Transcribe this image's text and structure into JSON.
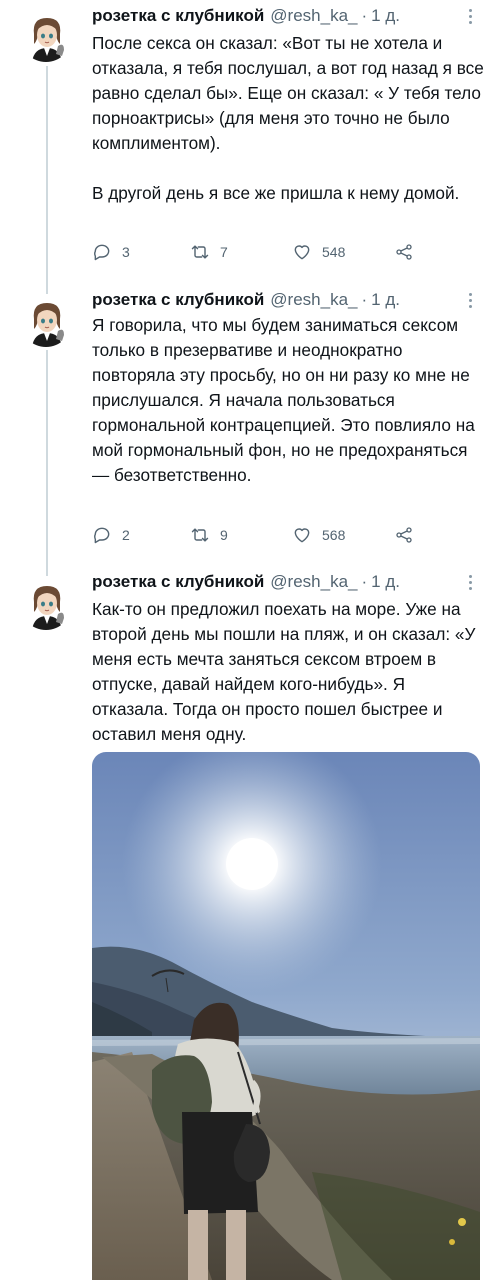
{
  "colors": {
    "text": "#0f1419",
    "secondary": "#536471",
    "line": "#cfd9de",
    "icon": "#536471"
  },
  "tweets": [
    {
      "name": "розетка с клубникой",
      "handle": "@resh_ka_",
      "separator": "·",
      "time": "1 д.",
      "text": "После секса он сказал: «Вот ты не хотела и отказала, я тебя послушал, а вот год назад я все равно сделал бы». Еще он сказал: « У тебя тело порноактрисы» (для меня это точно не было комплиментом).\n\nВ другой день я все же пришла к нему домой.",
      "replies": "3",
      "retweets": "7",
      "likes": "548"
    },
    {
      "name": "розетка с клубникой",
      "handle": "@resh_ka_",
      "separator": "·",
      "time": "1 д.",
      "text": "Я говорила, что мы будем заниматься сексом только в презервативе и неоднократно повторяла эту просьбу, но он ни разу ко мне не прислушался. Я начала пользоваться  гормональной контрацепцией. Это повлияло на мой гормональный фон, но не предохраняться — безответственно.",
      "replies": "2",
      "retweets": "9",
      "likes": "568"
    },
    {
      "name": "розетка с клубникой",
      "handle": "@resh_ka_",
      "separator": "·",
      "time": "1 д.",
      "text": "Как-то он предложил поехать на море. Уже на второй день мы пошли на пляж, и он сказал: «У меня есть мечта заняться сексом втроем в отпуске, давай найдем кого-нибудь». Я отказала. Тогда он просто пошел быстрее и оставил меня одну."
    }
  ]
}
